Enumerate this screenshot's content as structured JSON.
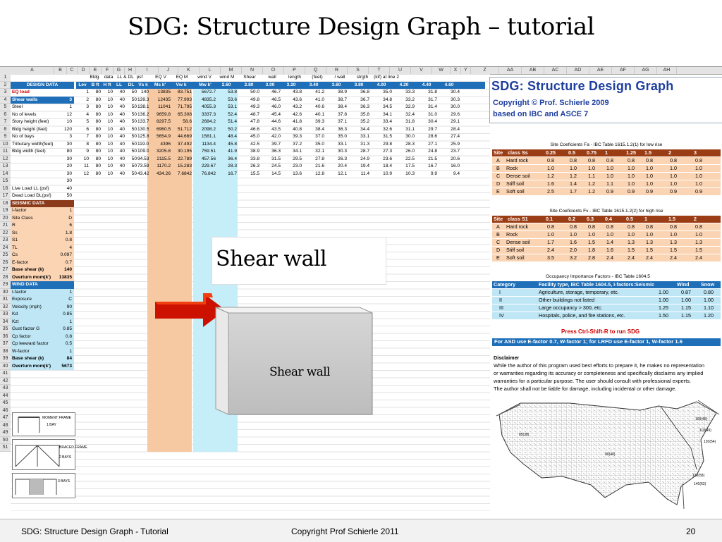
{
  "slide": {
    "title": "SDG: Structure Design Graph – tutorial",
    "callout": "Shear wall",
    "wall_label": "Shear wall"
  },
  "sheet": {
    "col_headers": [
      "A",
      "B",
      "C",
      "D",
      "E",
      "F",
      "G",
      "H",
      "I",
      "J",
      "K",
      "L",
      "M",
      "N",
      "O",
      "P",
      "Q",
      "R",
      "S",
      "T",
      "U",
      "V",
      "W",
      "X",
      "Y",
      "Z",
      "AA",
      "AB",
      "AC",
      "AD",
      "AE",
      "AF",
      "AG",
      "AH"
    ],
    "row_numbers": [
      "1",
      "2",
      "3",
      "4",
      "5",
      "6",
      "7",
      "8",
      "9",
      "10",
      "11",
      "12",
      "13",
      "14",
      "15",
      "16",
      "17",
      "18",
      "19",
      "20",
      "21",
      "22",
      "23",
      "24",
      "25",
      "26",
      "27",
      "28",
      "29",
      "30",
      "31",
      "32",
      "33",
      "34",
      "35",
      "36",
      "37",
      "38",
      "39",
      "40",
      "41",
      "42",
      "43",
      "44",
      "45",
      "46",
      "47",
      "48",
      "49",
      "50",
      "51"
    ],
    "header_row1": [
      "Bldg",
      "data",
      "LL & DL",
      "psf",
      "EQ V",
      "EQ M",
      "wind V",
      "wind M",
      "Shear",
      "wall",
      "length",
      "(feet)",
      "/ wall",
      "strgth",
      "(kif) at line 2"
    ],
    "header_row2": [
      "Lev",
      "B ft",
      "H ft",
      "LL",
      "DL",
      "Vs k",
      "Ms k'",
      "Vw k",
      "Mw k'",
      "2.60",
      "2.80",
      "3.00",
      "3.20",
      "3.40",
      "3.60",
      "3.80",
      "4.00",
      "4.20",
      "4.40",
      "4.60"
    ],
    "design_data_label": "DESIGN DATA",
    "seismic_label": "SEISMIC DATA",
    "wind_label": "WIND DATA",
    "params": [
      {
        "label": "EQ load",
        "value": ""
      },
      {
        "label": "Shear walls",
        "value": "3"
      },
      {
        "label": "Steel",
        "value": "1"
      },
      {
        "label": "No of levels",
        "value": "12"
      },
      {
        "label": "Story height (feet)",
        "value": "10"
      },
      {
        "label": "Bldg height (feet)",
        "value": "120"
      },
      {
        "label": "No of bays",
        "value": "3"
      },
      {
        "label": "Tributary width(feet)",
        "value": "30"
      },
      {
        "label": "Bldg width (feet)",
        "value": "80"
      },
      {
        "label": "",
        "value": "30"
      },
      {
        "label": "",
        "value": "20"
      },
      {
        "label": "",
        "value": "30"
      },
      {
        "label": "",
        "value": "30"
      },
      {
        "label": "Live Load LL (psf)",
        "value": "40"
      },
      {
        "label": "Dead Load DL(psf)",
        "value": "50"
      }
    ],
    "seismic": [
      {
        "label": "I-factor",
        "value": "1"
      },
      {
        "label": "Site Class",
        "value": "D"
      },
      {
        "label": "R",
        "value": "6"
      },
      {
        "label": "Ss",
        "value": "1.8"
      },
      {
        "label": "S1",
        "value": "0.8"
      },
      {
        "label": "TL",
        "value": "4"
      },
      {
        "label": "Cs",
        "value": "0.097"
      },
      {
        "label": "E-factor",
        "value": "0.7"
      },
      {
        "label": "Base shear (k)",
        "value": "140"
      },
      {
        "label": "Overturn mom(k')",
        "value": "13835"
      }
    ],
    "wind": [
      {
        "label": "I-factor",
        "value": "1"
      },
      {
        "label": "Exposure",
        "value": "C"
      },
      {
        "label": "Velocity (mph)",
        "value": "90"
      },
      {
        "label": "Kd",
        "value": "0.85"
      },
      {
        "label": "Kzt",
        "value": "1"
      },
      {
        "label": "Gust factor G",
        "value": "0.85"
      },
      {
        "label": "Cp factor",
        "value": "0.8"
      },
      {
        "label": "Cp leeward factor",
        "value": "0.5"
      },
      {
        "label": "W-factor",
        "value": "1"
      },
      {
        "label": "Base shear (k)",
        "value": "84"
      },
      {
        "label": "Overturn mom(k')",
        "value": "5673"
      }
    ],
    "levels": [
      [
        "1",
        "80",
        "10",
        "40",
        "50",
        "140",
        "13835",
        "83.751",
        "5672.7",
        "53.8",
        "50.0",
        "46.7",
        "43.8",
        "41.2",
        "38.9",
        "36.8",
        "35.0",
        "33.3",
        "31.8",
        "30.4"
      ],
      [
        "2",
        "80",
        "10",
        "40",
        "50",
        "139.37",
        "12435",
        "77.993",
        "4835.2",
        "53.6",
        "49.8",
        "46.5",
        "43.6",
        "41.0",
        "38.7",
        "36.7",
        "34.8",
        "33.2",
        "31.7",
        "30.3"
      ],
      [
        "3",
        "80",
        "10",
        "40",
        "50",
        "138.11",
        "11041",
        "71.795",
        "4055.3",
        "53.1",
        "49.3",
        "46.0",
        "43.2",
        "40.6",
        "38.4",
        "36.3",
        "34.5",
        "32.9",
        "31.4",
        "30.0"
      ],
      [
        "4",
        "80",
        "10",
        "40",
        "50",
        "136.22",
        "9659.8",
        "65.308",
        "3337.3",
        "52.4",
        "48.7",
        "45.4",
        "42.6",
        "40.1",
        "37.8",
        "35.8",
        "34.1",
        "32.4",
        "31.0",
        "29.6"
      ],
      [
        "5",
        "80",
        "10",
        "40",
        "50",
        "133.71",
        "8297.5",
        "58.6",
        "2684.2",
        "51.4",
        "47.8",
        "44.6",
        "41.8",
        "39.3",
        "37.1",
        "35.2",
        "33.4",
        "31.8",
        "30.4",
        "29.1"
      ],
      [
        "6",
        "80",
        "10",
        "40",
        "50",
        "130.56",
        "6960.5",
        "51.712",
        "2098.2",
        "50.2",
        "46.6",
        "43.5",
        "40.8",
        "38.4",
        "36.3",
        "34.4",
        "32.6",
        "31.1",
        "29.7",
        "28.4"
      ],
      [
        "7",
        "80",
        "10",
        "40",
        "50",
        "125.89",
        "5654.9",
        "44.669",
        "1581.1",
        "48.4",
        "45.0",
        "42.0",
        "39.3",
        "37.0",
        "35.0",
        "33.1",
        "31.5",
        "30.0",
        "28.6",
        "27.4"
      ],
      [
        "8",
        "80",
        "10",
        "40",
        "50",
        "119.02",
        "4396",
        "37.492",
        "1134.4",
        "45.8",
        "42.5",
        "39.7",
        "37.2",
        "35.0",
        "33.1",
        "31.3",
        "29.8",
        "28.3",
        "27.1",
        "25.9"
      ],
      [
        "9",
        "80",
        "10",
        "40",
        "50",
        "109.02",
        "3205.8",
        "30.195",
        "759.51",
        "41.9",
        "38.9",
        "36.3",
        "34.1",
        "32.1",
        "30.3",
        "28.7",
        "27.3",
        "26.0",
        "24.8",
        "23.7"
      ],
      [
        "10",
        "80",
        "10",
        "40",
        "50",
        "94.531",
        "2115.5",
        "22.789",
        "457.56",
        "36.4",
        "33.8",
        "31.5",
        "29.5",
        "27.8",
        "26.3",
        "24.9",
        "23.6",
        "22.5",
        "21.5",
        "20.6"
      ],
      [
        "11",
        "80",
        "10",
        "40",
        "50",
        "73.598",
        "1170.2",
        "15.283",
        "229.67",
        "28.3",
        "26.3",
        "24.5",
        "23.0",
        "21.6",
        "20.4",
        "19.4",
        "18.4",
        "17.5",
        "16.7",
        "16.0"
      ],
      [
        "12",
        "80",
        "10",
        "40",
        "50",
        "43.426",
        "434.26",
        "7.6842",
        "76.842",
        "16.7",
        "15.5",
        "14.5",
        "13.6",
        "12.8",
        "12.1",
        "11.4",
        "10.9",
        "10.3",
        "9.9",
        "9.4"
      ]
    ],
    "sketch_labels": [
      "MOMENT FRAME",
      "1 BAY",
      "BRACED FRAME",
      "2 BAYS",
      "3 BAYS"
    ]
  },
  "info": {
    "title": "SDG: Structure Design Graph",
    "copyright": "Copyright © Prof. Schierle 2009",
    "based": "based on IBC and ASCE 7",
    "fa": {
      "caption": "Site Coeficients Fa - IBC Table 1615.1.2(1) for low rise",
      "head": [
        "Site",
        "class Ss",
        "0.25",
        "0.5",
        "0.75",
        "1",
        "1.25",
        "1.5",
        "2",
        "3"
      ],
      "rows": [
        [
          "A",
          "Hard rock",
          "0.8",
          "0.8",
          "0.8",
          "0.8",
          "0.8",
          "0.8",
          "0.8",
          "0.8"
        ],
        [
          "B",
          "Rock",
          "1.0",
          "1.0",
          "1.0",
          "1.0",
          "1.0",
          "1.0",
          "1.0",
          "1.0"
        ],
        [
          "C",
          "Dense soil",
          "1.2",
          "1.2",
          "1.1",
          "1.0",
          "1.0",
          "1.0",
          "1.0",
          "1.0"
        ],
        [
          "D",
          "Stiff soil",
          "1.6",
          "1.4",
          "1.2",
          "1.1",
          "1.0",
          "1.0",
          "1.0",
          "1.0"
        ],
        [
          "E",
          "Soft soil",
          "2.5",
          "1.7",
          "1.2",
          "0.9",
          "0.9",
          "0.9",
          "0.9",
          "0.9"
        ]
      ]
    },
    "fv": {
      "caption": "Site Coeficients Fv - IBC Table 1615.1.2(2) for high rise",
      "head": [
        "Site",
        "class S1",
        "0.1",
        "0.2",
        "0.3",
        "0.4",
        "0.5",
        "1",
        "1.5",
        "2"
      ],
      "rows": [
        [
          "A",
          "Hard rock",
          "0.8",
          "0.8",
          "0.8",
          "0.8",
          "0.8",
          "0.8",
          "0.8",
          "0.8"
        ],
        [
          "B",
          "Rock",
          "1.0",
          "1.0",
          "1.0",
          "1.0",
          "1.0",
          "1.0",
          "1.0",
          "1.0"
        ],
        [
          "C",
          "Dense soil",
          "1.7",
          "1.6",
          "1.5",
          "1.4",
          "1.3",
          "1.3",
          "1.3",
          "1.3"
        ],
        [
          "D",
          "Stiff soil",
          "2.4",
          "2.0",
          "1.8",
          "1.6",
          "1.5",
          "1.5",
          "1.5",
          "1.5"
        ],
        [
          "E",
          "Soft soil",
          "3.5",
          "3.2",
          "2.8",
          "2.4",
          "2.4",
          "2.4",
          "2.4",
          "2.4"
        ]
      ]
    },
    "occupancy": {
      "caption": "Occupancy Importance Factors - IBC Table 1604.5",
      "head": [
        "Category",
        "Facility type, IBC Table 1604.5, I-factors:Seismic",
        "Wind",
        "Snow"
      ],
      "rows": [
        [
          "I",
          "Agriculture, storage, temporary, etc.",
          "1.00",
          "0.87",
          "0.80"
        ],
        [
          "II",
          "Other buildings not listed",
          "1.00",
          "1.00",
          "1.00"
        ],
        [
          "III",
          "Large occupancy > 300, etc.",
          "1.25",
          "1.15",
          "1.10"
        ],
        [
          "IV",
          "Hospitals, police, and fire stations, etc.",
          "1.50",
          "1.15",
          "1.20"
        ]
      ]
    },
    "press": "Press Ctrl-Shift-R to run SDG",
    "factor_note": "For ASD use E-factor 0.7, W-factor 1; for LRFD use E-factor 1, W-factor 1.6",
    "disclaimer_title": "Disclaimer",
    "disclaimer": [
      "While the author of this program used best efforts to prepare it, he makes no representation",
      "or warranties regarding its accuracy or completeness and specifically disclaims any implied",
      "warranties for a particular purpose.  The user should consult with professional experts.",
      "The author shall not be liable for damage, including incidental or other damage."
    ],
    "map_labels": [
      "100(45)",
      "110(49)",
      "120(54)",
      "90(40)",
      "85(38)",
      "130(58)",
      "140(63)"
    ]
  },
  "footer": {
    "left": "SDG: Structure Design Graph - Tutorial",
    "center": "Copyright Prof Schierle 2011",
    "page": "20"
  },
  "colors": {
    "blue_header": "#1f6fb8",
    "brown_header": "#8b3a1a",
    "peach": "#fbd4b4",
    "light_blue": "#bfe6f5",
    "orange_band": "#f7c9a2",
    "cyan_band": "#c6eef8",
    "red_text": "#d00000"
  }
}
